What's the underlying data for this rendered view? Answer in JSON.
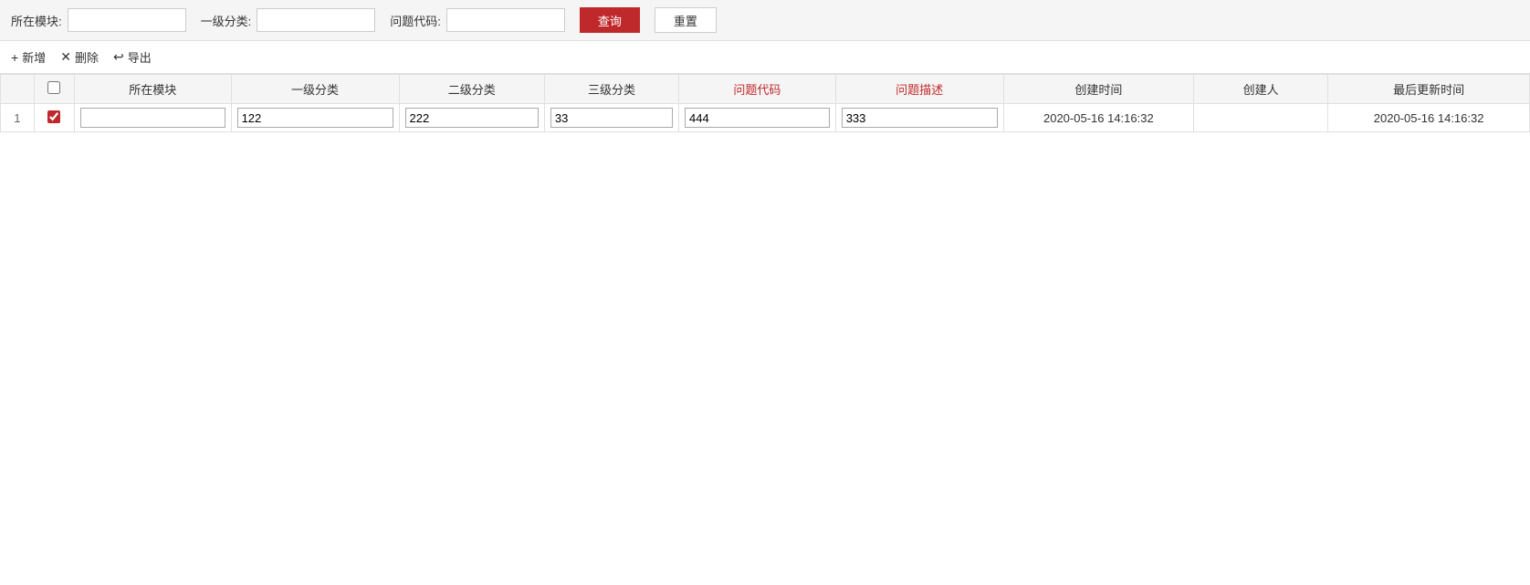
{
  "search": {
    "module_label": "所在模块:",
    "module_value": "",
    "cat1_label": "一级分类:",
    "cat1_value": "",
    "code_label": "问题代码:",
    "code_value": "",
    "query_btn": "查询",
    "reset_btn": "重置"
  },
  "toolbar": {
    "add_label": "新增",
    "delete_label": "删除",
    "export_label": "导出"
  },
  "table": {
    "headers": {
      "checkbox": "",
      "module": "所在模块",
      "cat1": "一级分类",
      "cat2": "二级分类",
      "cat3": "三级分类",
      "code": "问题代码",
      "desc": "问题描述",
      "create_time": "创建时间",
      "creator": "创建人",
      "update_time": "最后更新时间"
    },
    "rows": [
      {
        "index": "1",
        "checked": true,
        "module": "",
        "cat1": "122",
        "cat2": "222",
        "cat3": "33",
        "code": "444",
        "desc": "333",
        "create_time": "2020-05-16 14:16:32",
        "creator": "",
        "update_time": "2020-05-16 14:16:32"
      }
    ]
  }
}
